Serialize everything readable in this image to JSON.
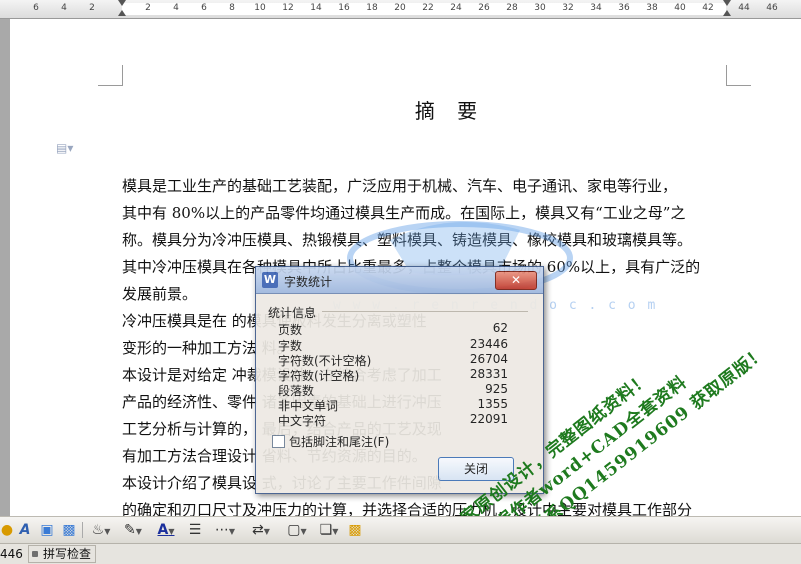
{
  "ruler": {
    "labels": [
      "6",
      "4",
      "2",
      "2",
      "4",
      "6",
      "8",
      "10",
      "12",
      "14",
      "16",
      "18",
      "20",
      "22",
      "24",
      "26",
      "28",
      "30",
      "32",
      "34",
      "36",
      "38",
      "40",
      "42",
      "44",
      "46"
    ]
  },
  "document": {
    "title": "摘  要",
    "paragraph_lines": [
      "        模具是工业生产的基础工艺装配，广泛应用于机械、汽车、电子通讯、家电等行业，",
      "其中有 80%以上的产品零件均通过模具生产而成。在国际上，模具又有“工业之母”之",
      "称。模具分为冷冲压模具、热锻模具、塑料模具、铸造模具、橡校模具和玻璃模具等。",
      "其中冷冲压模具在各种模具中所占比重最多，占整个模具市场的 60%以上，具有广泛的",
      "发展前景。",
      "        冷冲压模具是在                                                  的模具使板料发生分离或塑性",
      "变形的一种加工方法                                                  料。",
      "        本设计是对给定                                                  冲裁模设计，在综合考虑了加工",
      "产品的经济性、零件                                                  诸多因素的基础上进行冲压",
      "工艺分析与计算的，                                                  最后，结合产品的工艺及现",
      "有加工方法合理设计                                                  省料、节约资源的目的。",
      "本设计介绍了模具设                                                  式，讨论了主要工作件间隙",
      "的确定和刃口尺寸及冲压力的计算，并选择合适的压力机，设计中主要对模具工作部分"
    ]
  },
  "watermark": {
    "url": "w w w . r e n r e n d o c . c o m",
    "green_line1": "独家原创设计，完整图纸资料！",
    "green_line2": "根据作者word+CAD全套资料",
    "green_line3": "请联系QQ1459919609 获取原版！"
  },
  "dialog": {
    "app_icon": "W",
    "title": "字数统计",
    "close_x": "✕",
    "group_label": "统计信息",
    "stats": [
      {
        "label": "页数",
        "value": "62"
      },
      {
        "label": "字数",
        "value": "23446"
      },
      {
        "label": "字符数(不计空格)",
        "value": "26704"
      },
      {
        "label": "字符数(计空格)",
        "value": "28331"
      },
      {
        "label": "段落数",
        "value": "925"
      },
      {
        "label": "非中文单词",
        "value": "1355"
      },
      {
        "label": "中文字符",
        "value": "22091"
      }
    ],
    "checkbox_label": "包括脚注和尾注(F)",
    "checkbox_checked": false,
    "close_button": "关闭"
  },
  "toolbar": {
    "icons": [
      "shapes-icon",
      "text-art-icon",
      "picture-icon",
      "screenshot-icon",
      "fill-color-icon",
      "line-color-icon",
      "font-color-icon",
      "line-style-icon",
      "dash-style-icon",
      "arrow-style-icon",
      "shadow-icon",
      "3d-icon",
      "arrange-icon"
    ]
  },
  "status": {
    "word_count_fragment": "446",
    "spellcheck": "拼写检查"
  }
}
